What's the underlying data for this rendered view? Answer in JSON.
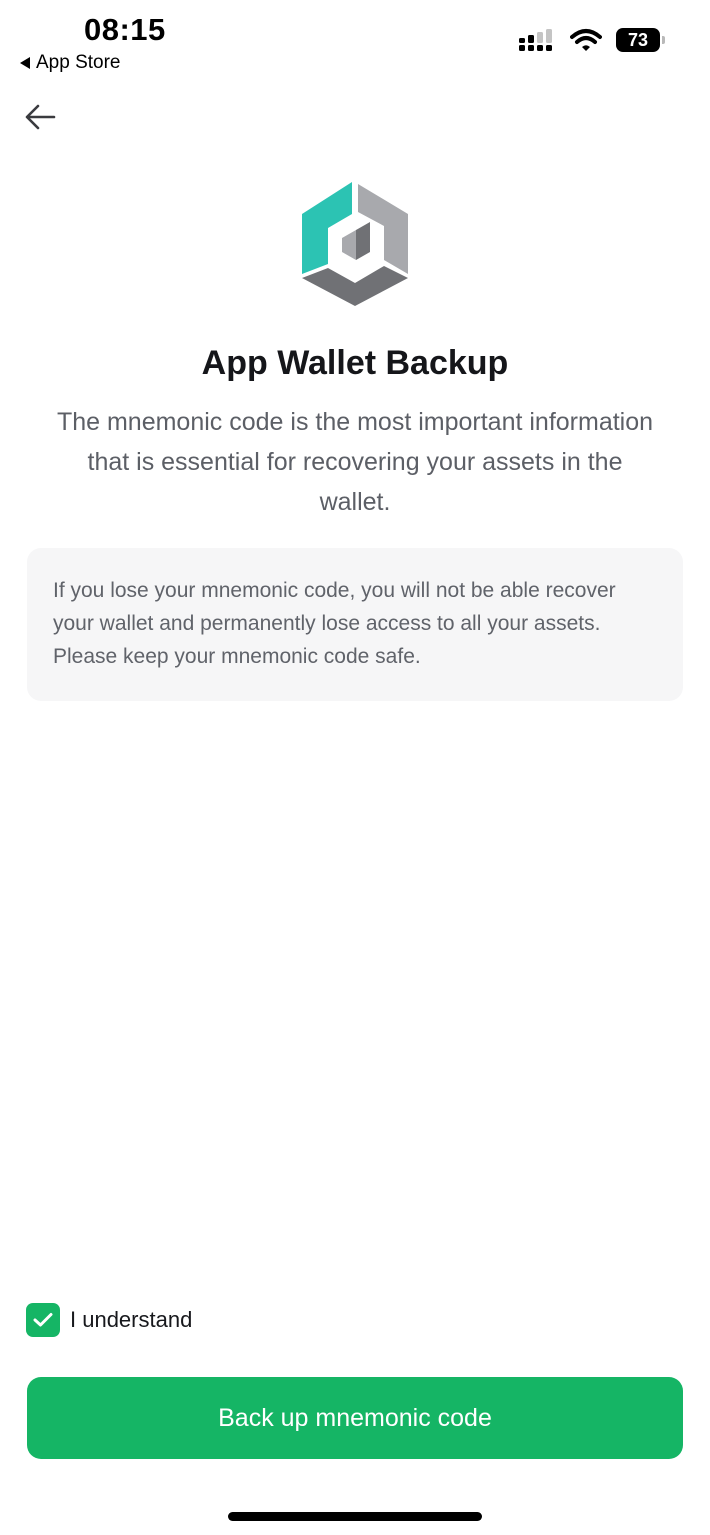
{
  "status_bar": {
    "time": "08:15",
    "back_app": "App Store",
    "battery": "73"
  },
  "header": {
    "back_icon": "arrow-left-icon"
  },
  "logo": {
    "icon": "wallet-logo-icon",
    "colors": {
      "teal": "#2cc3b3",
      "gray_light": "#a8a9ad",
      "gray_dark": "#707175"
    }
  },
  "main": {
    "title": "App Wallet Backup",
    "subtitle": "The mnemonic code is the most important information that is essential for recovering your assets in the wallet.",
    "notice": "If you lose your mnemonic code, you will not be able recover your wallet and permanently lose access to all your assets. Please keep your mnemonic code safe."
  },
  "agreement": {
    "checked": true,
    "label": "I understand"
  },
  "actions": {
    "primary_label": "Back up mnemonic code",
    "accent_color": "#15b565"
  }
}
